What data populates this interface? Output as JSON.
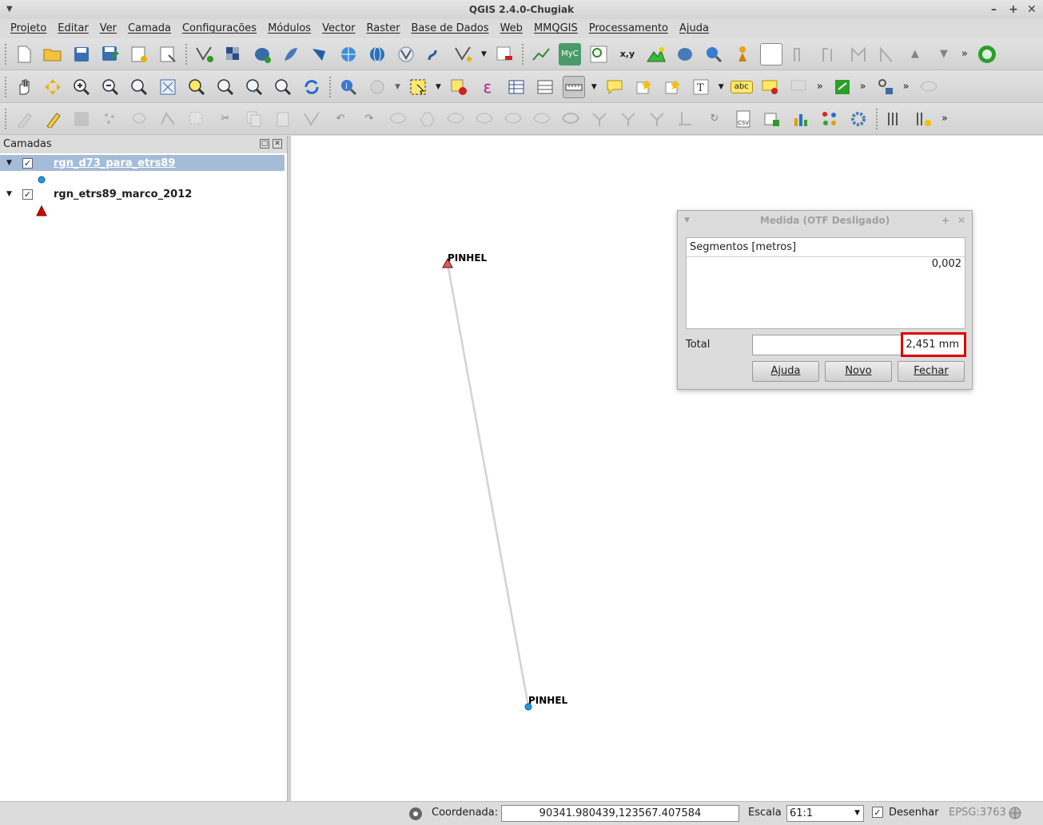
{
  "window": {
    "title": "QGIS 2.4.0-Chugiak"
  },
  "menu": [
    "Projeto",
    "Editar",
    "Ver",
    "Camada",
    "Configurações",
    "Módulos",
    "Vector",
    "Raster",
    "Base de Dados",
    "Web",
    "MMQGIS",
    "Processamento",
    "Ajuda"
  ],
  "toolbar_text": {
    "myc": "MyC",
    "xy": "x,y",
    "csv": "CSV",
    "abc": "abc",
    "overflow": "»"
  },
  "layers_panel": {
    "title": "Camadas",
    "layers": [
      {
        "name": "rgn_d73_para_etrs89",
        "checked": true,
        "selected": true,
        "symbol": "blue-circle"
      },
      {
        "name": "rgn_etrs89_marco_2012",
        "checked": true,
        "selected": false,
        "symbol": "red-triangle"
      }
    ]
  },
  "map": {
    "labels": [
      "PINHEL",
      "PINHEL"
    ]
  },
  "measure_dialog": {
    "title": "Medida (OTF Desligado)",
    "segments_header": "Segmentos [metros]",
    "segments": [
      "0,002"
    ],
    "total_label": "Total",
    "total_value": "2,451 mm",
    "buttons": {
      "help": "Ajuda",
      "new": "Novo",
      "close": "Fechar"
    }
  },
  "statusbar": {
    "coord_label": "Coordenada:",
    "coord_value": "90341.980439,123567.407584",
    "scale_label": "Escala",
    "scale_value": "61:1",
    "render_label": "Desenhar",
    "render_checked": true,
    "crs": "EPSG:3763"
  },
  "colors": {
    "highlight": "#e00000",
    "selection": "#9fb7d4",
    "point_blue": "#1e9be0",
    "triangle_red": "#d40000"
  }
}
